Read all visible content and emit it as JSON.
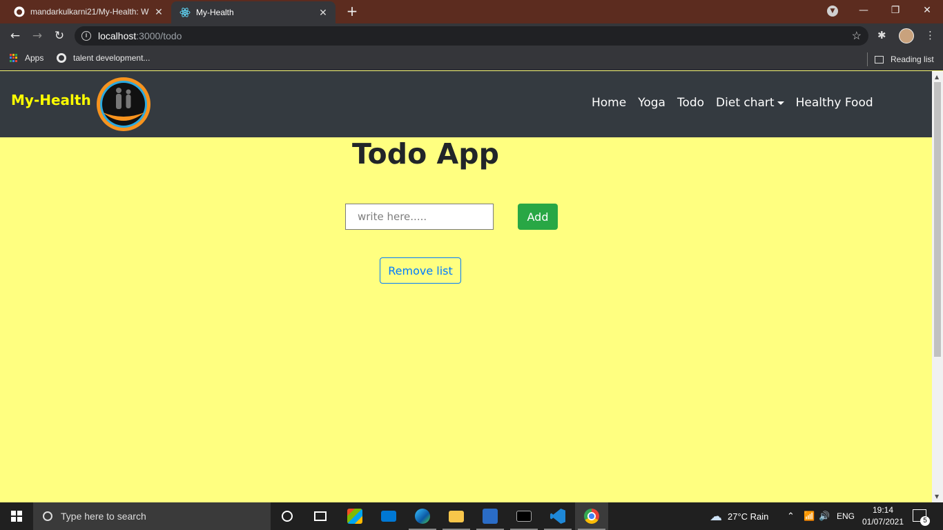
{
  "browser": {
    "tabs": [
      {
        "title": "mandarkulkarni21/My-Health: W",
        "active": false
      },
      {
        "title": "My-Health",
        "active": true
      }
    ],
    "address": {
      "host": "localhost",
      "path": ":3000/todo"
    },
    "bookmarks": [
      {
        "label": "Apps",
        "icon": "apps-grid-icon"
      },
      {
        "label": "talent development...",
        "icon": "globe-icon"
      }
    ],
    "reading_list_label": "Reading list"
  },
  "navbar": {
    "brand": "My-Health",
    "links": [
      "Home",
      "Yoga",
      "Todo",
      "Diet chart",
      "Healthy Food"
    ]
  },
  "main": {
    "title": "Todo App",
    "input_placeholder": "write here.....",
    "add_label": "Add",
    "remove_label": "Remove list"
  },
  "taskbar": {
    "search_placeholder": "Type here to search",
    "weather": "27°C  Rain",
    "language": "ENG",
    "time": "19:14",
    "date": "01/07/2021",
    "notification_count": "5"
  },
  "colors": {
    "page_bg": "#ffff80",
    "navbar_bg": "#343a40",
    "brand": "#ffff00",
    "add_button": "#28a745",
    "remove_button": "#007bff"
  }
}
